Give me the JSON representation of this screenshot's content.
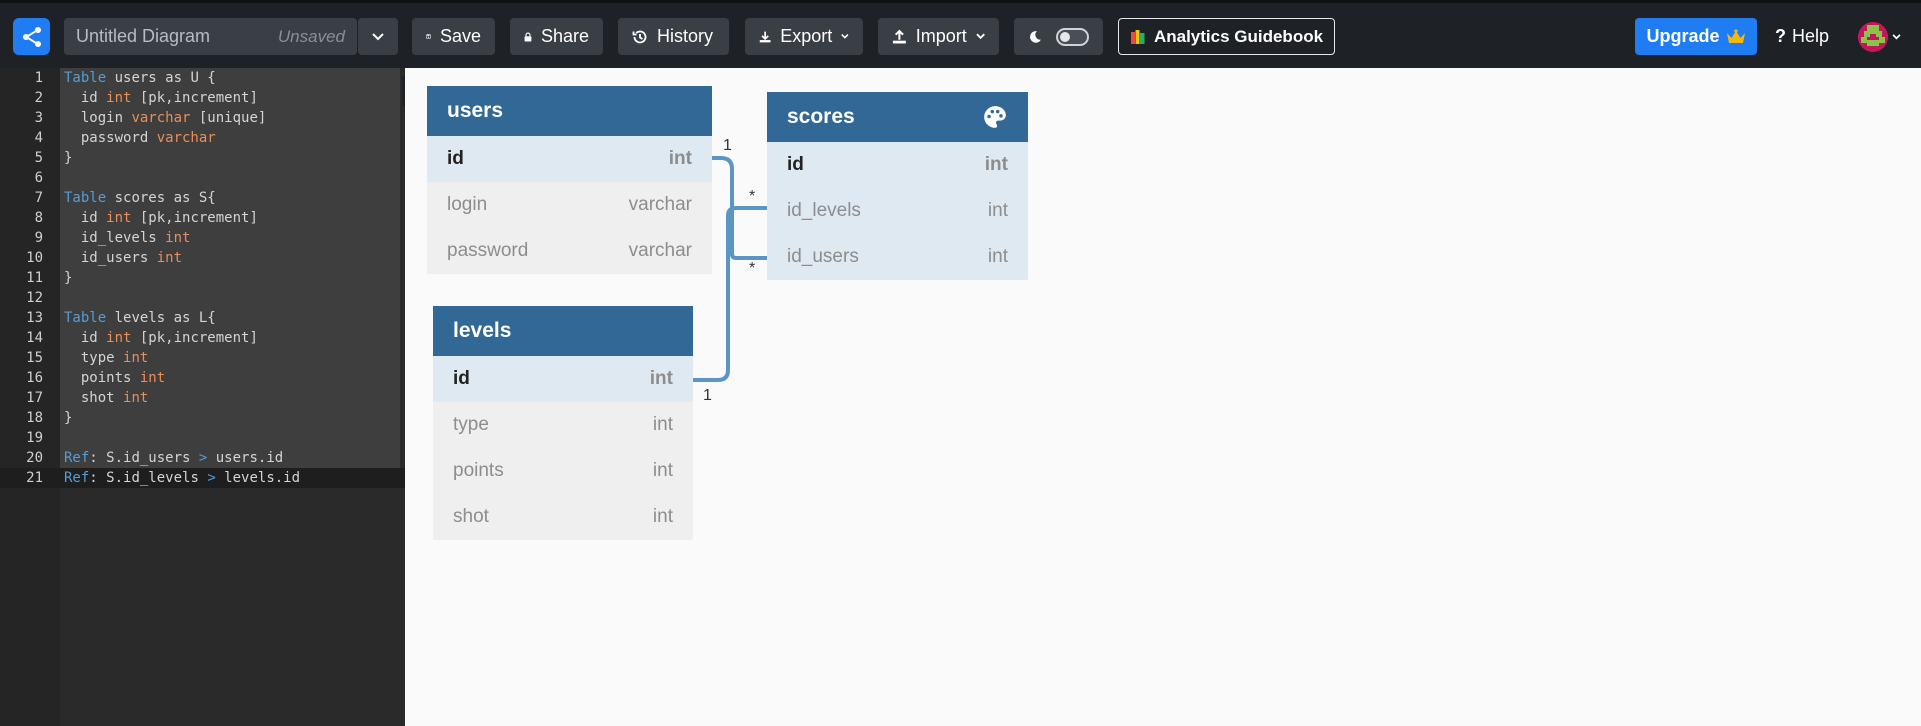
{
  "header": {
    "title": "Untitled Diagram",
    "status": "Unsaved",
    "buttons": {
      "save": "Save",
      "share": "Share",
      "history": "History",
      "export": "Export",
      "import": "Import",
      "guide": "Analytics Guidebook",
      "upgrade": "Upgrade",
      "help": "Help"
    },
    "accent": "#1f7cf3"
  },
  "editor": {
    "line_numbers": [
      "1",
      "2",
      "3",
      "4",
      "5",
      "6",
      "7",
      "8",
      "9",
      "10",
      "11",
      "12",
      "13",
      "14",
      "15",
      "16",
      "17",
      "18",
      "19",
      "20",
      "21"
    ]
  },
  "tables": {
    "users": {
      "name": "users",
      "fields": [
        {
          "name": "id",
          "type": "int"
        },
        {
          "name": "login",
          "type": "varchar"
        },
        {
          "name": "password",
          "type": "varchar"
        }
      ]
    },
    "scores": {
      "name": "scores",
      "fields": [
        {
          "name": "id",
          "type": "int"
        },
        {
          "name": "id_levels",
          "type": "int"
        },
        {
          "name": "id_users",
          "type": "int"
        }
      ]
    },
    "levels": {
      "name": "levels",
      "fields": [
        {
          "name": "id",
          "type": "int"
        },
        {
          "name": "type",
          "type": "int"
        },
        {
          "name": "points",
          "type": "int"
        },
        {
          "name": "shot",
          "type": "int"
        }
      ]
    }
  },
  "relations": {
    "users_one": "1",
    "scores_many_a": "*",
    "scores_many_b": "*",
    "levels_one": "1"
  },
  "colors": {
    "table_header": "#316896",
    "relation_line": "#5b95c6"
  }
}
